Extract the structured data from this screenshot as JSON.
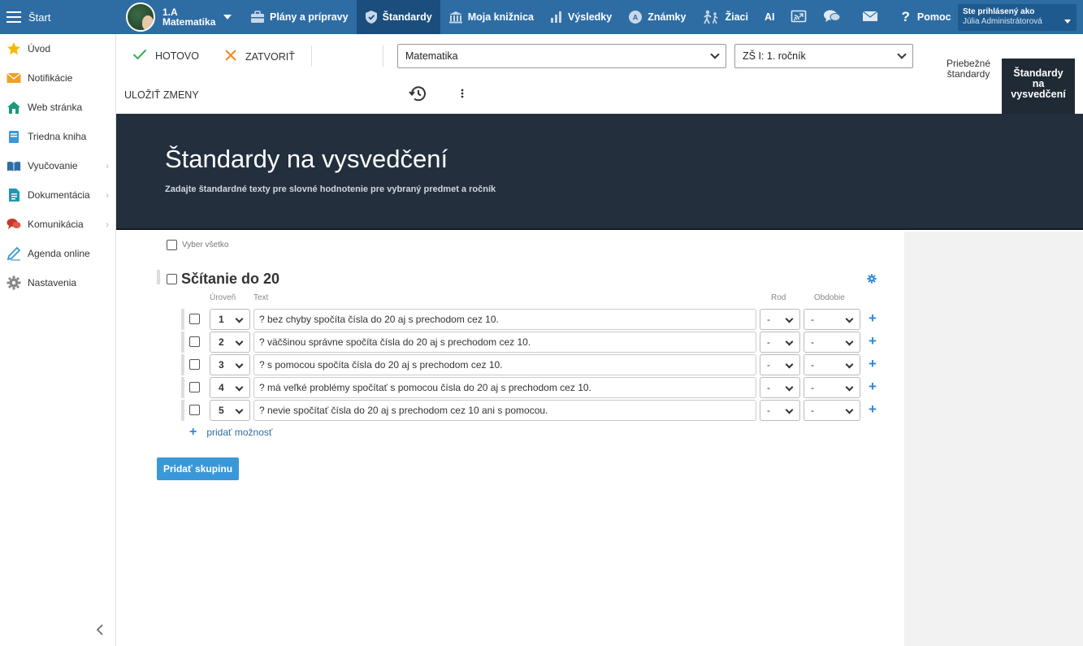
{
  "topbar": {
    "start_label": "Štart",
    "class_line1": "1.A",
    "class_line2": "Matematika",
    "nav": [
      {
        "label": "Plány a prípravy",
        "icon": "briefcase-icon"
      },
      {
        "label": "Štandardy",
        "icon": "shield-icon",
        "active": true
      },
      {
        "label": "Moja knižnica",
        "icon": "library-icon"
      },
      {
        "label": "Výsledky",
        "icon": "bar-chart-icon"
      },
      {
        "label": "Známky",
        "icon": "grade-icon"
      },
      {
        "label": "Žiaci",
        "icon": "students-icon"
      },
      {
        "label": "AI",
        "icon": ""
      }
    ],
    "help_label": "Pomoc",
    "user_title": "Ste prihlásený ako",
    "user_name": "Júlia Administrátorová"
  },
  "sidebar": {
    "items": [
      {
        "label": "Úvod",
        "icon": "star-icon",
        "color": "#f5b800"
      },
      {
        "label": "Notifikácie",
        "icon": "envelope-icon",
        "color": "#f0a020"
      },
      {
        "label": "Web stránka",
        "icon": "home-icon",
        "color": "#1a9a7a"
      },
      {
        "label": "Triedna kniha",
        "icon": "book-icon",
        "color": "#3a98d8"
      },
      {
        "label": "Vyučovanie",
        "icon": "open-book-icon",
        "color": "#2e6da4"
      },
      {
        "label": "Dokumentácia",
        "icon": "document-icon",
        "color": "#1a9ab0"
      },
      {
        "label": "Komunikácia",
        "icon": "chat-icon",
        "color": "#c0392b"
      },
      {
        "label": "Agenda online",
        "icon": "pencil-icon",
        "color": "#3a98d8"
      },
      {
        "label": "Nastavenia",
        "icon": "gear-icon",
        "color": "#888888"
      }
    ]
  },
  "toolbar": {
    "done_label": "HOTOVO",
    "close_label": "ZATVORIŤ",
    "save_label": "ULOŽIŤ ZMENY",
    "subject_value": "Matematika",
    "grade_value": "ZŠ I: 1. ročník",
    "tab_running": "Priebežné štandardy",
    "tab_report_1": "Štandardy",
    "tab_report_2": "na",
    "tab_report_3": "vysvedčení"
  },
  "banner": {
    "title": "Štandardy na vysvedčení",
    "subtitle": "Zadajte štandardné texty pre slovné hodnotenie pre vybraný predmet a ročník"
  },
  "content": {
    "select_all": "Vyber všetko",
    "group_title": "Sčítanie do 20",
    "col_level": "Úroveň",
    "col_text": "Text",
    "col_gender": "Rod",
    "col_period": "Obdobie",
    "rows": [
      {
        "level": "1",
        "text": "? bez chyby spočíta čísla do 20 aj s prechodom cez 10.",
        "gender": "-",
        "period": "-"
      },
      {
        "level": "2",
        "text": "? väčšinou správne spočíta čísla do 20 aj s prechodom cez 10.",
        "gender": "-",
        "period": "-"
      },
      {
        "level": "3",
        "text": "? s pomocou spočíta čísla do 20 aj s prechodom cez 10.",
        "gender": "-",
        "period": "-"
      },
      {
        "level": "4",
        "text": "? má veľké problémy spočítať s pomocou čísla do 20 aj s prechodom cez 10.",
        "gender": "-",
        "period": "-"
      },
      {
        "level": "5",
        "text": "? nevie spočítať čísla do 20 aj s prechodom cez 10 ani s pomocou.",
        "gender": "-",
        "period": "-"
      }
    ],
    "add_option": "pridať možnosť",
    "add_group": "Pridať skupinu"
  },
  "colors": {
    "topbar": "#2e6da4",
    "topbar_active": "#1b4e7d",
    "banner": "#242f3e",
    "accent": "#3a98d8"
  }
}
